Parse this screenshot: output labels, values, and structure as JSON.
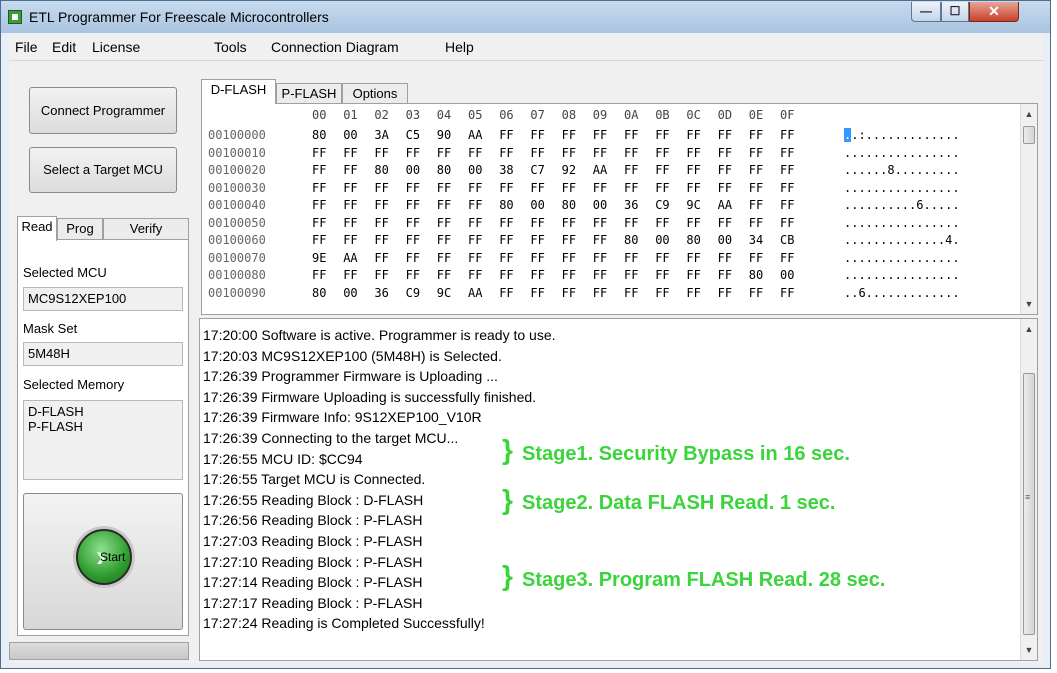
{
  "window": {
    "title": "ETL Programmer For Freescale Microcontrollers",
    "controls": {
      "minimize": "—",
      "maximize": "☐",
      "close": "✕"
    }
  },
  "menu": [
    "File",
    "Edit",
    "License",
    "Tools",
    "Connection Diagram",
    "Help"
  ],
  "left": {
    "connect_label": "Connect Programmer",
    "select_target_label": "Select a Target MCU",
    "tabs": [
      "Read",
      "Prog",
      "Verify"
    ],
    "active_tab": "Read",
    "selected_mcu_label": "Selected MCU",
    "selected_mcu_value": "MC9S12XEP100",
    "mask_set_label": "Mask Set",
    "mask_set_value": "5M48H",
    "selected_memory_label": "Selected Memory",
    "selected_memory_items": [
      "D-FLASH",
      "P-FLASH"
    ],
    "start_label": "Start"
  },
  "hex": {
    "tabs": [
      "D-FLASH",
      "P-FLASH",
      "Options"
    ],
    "active_tab": "D-FLASH",
    "header": [
      "00",
      "01",
      "02",
      "03",
      "04",
      "05",
      "06",
      "07",
      "08",
      "09",
      "0A",
      "0B",
      "0C",
      "0D",
      "0E",
      "0F"
    ],
    "rows": [
      {
        "addr": "00100000",
        "bytes": [
          "80",
          "00",
          "3A",
          "C5",
          "90",
          "AA",
          "FF",
          "FF",
          "FF",
          "FF",
          "FF",
          "FF",
          "FF",
          "FF",
          "FF",
          "FF"
        ],
        "ascii": "..:............."
      },
      {
        "addr": "00100010",
        "bytes": [
          "FF",
          "FF",
          "FF",
          "FF",
          "FF",
          "FF",
          "FF",
          "FF",
          "FF",
          "FF",
          "FF",
          "FF",
          "FF",
          "FF",
          "FF",
          "FF"
        ],
        "ascii": "................"
      },
      {
        "addr": "00100020",
        "bytes": [
          "FF",
          "FF",
          "80",
          "00",
          "80",
          "00",
          "38",
          "C7",
          "92",
          "AA",
          "FF",
          "FF",
          "FF",
          "FF",
          "FF",
          "FF"
        ],
        "ascii": "......8........."
      },
      {
        "addr": "00100030",
        "bytes": [
          "FF",
          "FF",
          "FF",
          "FF",
          "FF",
          "FF",
          "FF",
          "FF",
          "FF",
          "FF",
          "FF",
          "FF",
          "FF",
          "FF",
          "FF",
          "FF"
        ],
        "ascii": "................"
      },
      {
        "addr": "00100040",
        "bytes": [
          "FF",
          "FF",
          "FF",
          "FF",
          "FF",
          "FF",
          "80",
          "00",
          "80",
          "00",
          "36",
          "C9",
          "9C",
          "AA",
          "FF",
          "FF"
        ],
        "ascii": "..........6....."
      },
      {
        "addr": "00100050",
        "bytes": [
          "FF",
          "FF",
          "FF",
          "FF",
          "FF",
          "FF",
          "FF",
          "FF",
          "FF",
          "FF",
          "FF",
          "FF",
          "FF",
          "FF",
          "FF",
          "FF"
        ],
        "ascii": "................"
      },
      {
        "addr": "00100060",
        "bytes": [
          "FF",
          "FF",
          "FF",
          "FF",
          "FF",
          "FF",
          "FF",
          "FF",
          "FF",
          "FF",
          "80",
          "00",
          "80",
          "00",
          "34",
          "CB"
        ],
        "ascii": "..............4."
      },
      {
        "addr": "00100070",
        "bytes": [
          "9E",
          "AA",
          "FF",
          "FF",
          "FF",
          "FF",
          "FF",
          "FF",
          "FF",
          "FF",
          "FF",
          "FF",
          "FF",
          "FF",
          "FF",
          "FF"
        ],
        "ascii": "................"
      },
      {
        "addr": "00100080",
        "bytes": [
          "FF",
          "FF",
          "FF",
          "FF",
          "FF",
          "FF",
          "FF",
          "FF",
          "FF",
          "FF",
          "FF",
          "FF",
          "FF",
          "FF",
          "80",
          "00"
        ],
        "ascii": "................"
      },
      {
        "addr": "00100090",
        "bytes": [
          "80",
          "00",
          "36",
          "C9",
          "9C",
          "AA",
          "FF",
          "FF",
          "FF",
          "FF",
          "FF",
          "FF",
          "FF",
          "FF",
          "FF",
          "FF"
        ],
        "ascii": "..6............."
      }
    ]
  },
  "log": [
    "17:20:00 Software is active. Programmer is ready to use.",
    "17:20:03 MC9S12XEP100 (5M48H) is Selected.",
    "17:26:39 Programmer Firmware is Uploading ...",
    "17:26:39 Firmware Uploading is successfully finished.",
    "17:26:39 Firmware Info: 9S12XEP100_V10R",
    "17:26:39 Connecting to the target MCU...",
    "17:26:55 MCU ID: $CC94",
    "17:26:55 Target MCU is Connected.",
    "17:26:55 Reading Block : D-FLASH",
    "17:26:56 Reading Block : P-FLASH",
    "17:27:03 Reading Block : P-FLASH",
    "17:27:10 Reading Block : P-FLASH",
    "17:27:14 Reading Block : P-FLASH",
    "17:27:17 Reading Block : P-FLASH",
    "17:27:24 Reading is Completed Successfully!"
  ],
  "annotations": {
    "stage1": "Stage1. Security Bypass in 16 sec.",
    "stage2": "Stage2. Data FLASH Read. 1 sec.",
    "stage3": "Stage3. Program FLASH Read. 28 sec.",
    "color": "#3bd43b"
  },
  "icons": {
    "brace": "}",
    "scroll_up": "▲",
    "scroll_down": "▼",
    "grip": "≡"
  }
}
